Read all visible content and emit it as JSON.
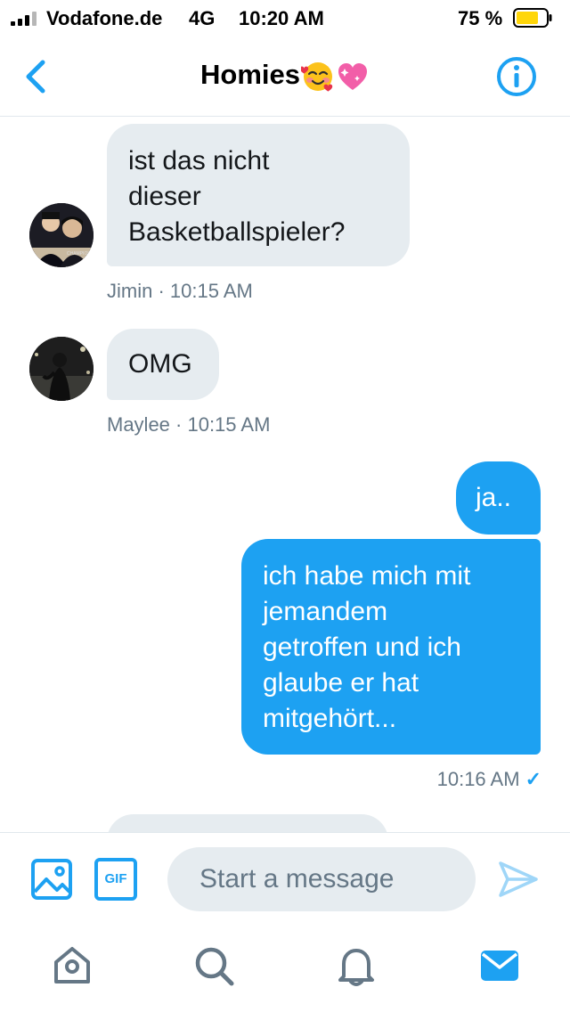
{
  "status_bar": {
    "carrier": "Vodafone.de",
    "network": "4G",
    "time": "10:20 AM",
    "battery": "75 %",
    "battery_level": 0.75
  },
  "header": {
    "title": "Homies",
    "emojis": [
      "smiling-face-with-hearts-icon",
      "sparkling-heart-icon"
    ]
  },
  "messages": [
    {
      "text": "ist das nicht\ndieser\nBasketballspieler?",
      "meta": "Jimin · 10:15 AM"
    },
    {
      "text": "OMG",
      "meta": "Maylee · 10:15 AM"
    },
    {
      "text": "ja.."
    },
    {
      "text": "ich habe mich mit\njemandem\ngetroffen und ich\nglaube er hat\nmitgehört...",
      "meta": "10:16 AM",
      "status": "✓"
    }
  ],
  "compose": {
    "placeholder": "Start a message",
    "gif_label": "GIF"
  },
  "colors": {
    "accent": "#1da1f2",
    "incoming_bubble": "#e6ecf0",
    "secondary_text": "#657786",
    "icon_gray": "#657786"
  },
  "tabs": [
    "home-icon",
    "search-icon",
    "notifications-icon",
    "messages-icon"
  ]
}
